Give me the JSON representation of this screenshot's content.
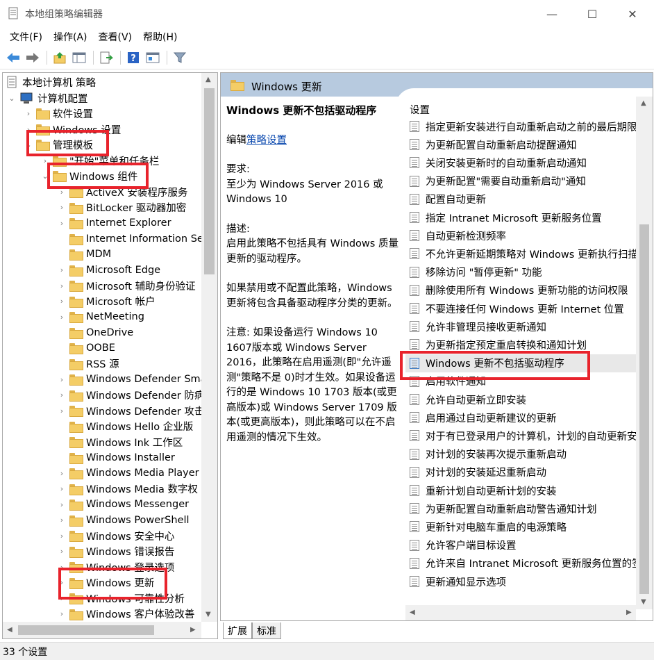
{
  "window": {
    "title": "本地组策略编辑器",
    "minimize": "—",
    "maximize": "☐",
    "close": "✕"
  },
  "menu": [
    "文件(F)",
    "操作(A)",
    "查看(V)",
    "帮助(H)"
  ],
  "tree": {
    "root": "本地计算机 策略",
    "computer_config": "计算机配置",
    "software_settings": "软件设置",
    "windows_settings": "Windows 设置",
    "admin_templates": "管理模板",
    "start_menu": "\"开始\"菜单和任务栏",
    "windows_components": "Windows 组件",
    "components": [
      "ActiveX 安装程序服务",
      "BitLocker 驱动器加密",
      "Internet Explorer",
      "Internet Information Ser",
      "MDM",
      "Microsoft Edge",
      "Microsoft 辅助身份验证",
      "Microsoft 帐户",
      "NetMeeting",
      "OneDrive",
      "OOBE",
      "RSS 源",
      "Windows Defender Sma",
      "Windows Defender 防病",
      "Windows Defender 攻击",
      "Windows Hello 企业版",
      "Windows Ink 工作区",
      "Windows Installer",
      "Windows Media Player",
      "Windows Media 数字权",
      "Windows Messenger",
      "Windows PowerShell",
      "Windows 安全中心",
      "Windows 错误报告",
      "Windows 登录选项",
      "Windows 更新",
      "Windows 可靠性分析",
      "Windows 客户体验改善"
    ]
  },
  "right": {
    "header": "Windows 更新",
    "description": {
      "title": "Windows 更新不包括驱动程序",
      "edit_prefix": "编辑",
      "edit_link": "策略设置",
      "requirement_label": "要求:",
      "requirement_text": "至少为 Windows Server 2016 或 Windows 10",
      "desc_label": "描述:",
      "desc_text": "启用此策略不包括具有 Windows 质量更新的驱动程序。",
      "disabled_text": "如果禁用或不配置此策略，Windows 更新将包含具备驱动程序分类的更新。",
      "note_text": "注意: 如果设备运行 Windows 10 1607版本或 Windows Server 2016，此策略在启用遥测(即\"允许遥测\"策略不是 0)时才生效。如果设备运行的是 Windows 10 1703 版本(或更高版本)或 Windows Server 1709 版本(或更高版本)，则此策略可以在不启用遥测的情况下生效。"
    },
    "list_header": "设置",
    "settings": [
      "指定更新安装进行自动重新启动之前的最后期限",
      "为更新配置自动重新启动提醒通知",
      "关闭安装更新时的自动重新启动通知",
      "为更新配置\"需要自动重新启动\"通知",
      "配置自动更新",
      "指定 Intranet Microsoft 更新服务位置",
      "自动更新检测频率",
      "不允许更新延期策略对 Windows 更新执行扫描",
      "移除访问 \"暂停更新\" 功能",
      "删除使用所有 Windows 更新功能的访问权限",
      "不要连接任何 Windows 更新 Internet 位置",
      "允许非管理员接收更新通知",
      "为更新指定预定重启转换和通知计划",
      "Windows 更新不包括驱动程序",
      "启用软件通知",
      "允许自动更新立即安装",
      "启用通过自动更新建议的更新",
      "对于有已登录用户的计算机，计划的自动更新安装",
      "对计划的安装再次提示重新启动",
      "对计划的安装延迟重新启动",
      "重新计划自动更新计划的安装",
      "为更新配置自动重新启动警告通知计划",
      "更新针对电脑车重启的电源策略",
      "允许客户端目标设置",
      "允许来自 Intranet Microsoft 更新服务位置的签",
      "更新通知显示选项"
    ],
    "selected_index": 13
  },
  "tabs": [
    "扩展",
    "标准"
  ],
  "status": "33 个设置",
  "colors": {
    "highlight": "#e8232c",
    "header_bg": "#b7cadf",
    "link": "#0645ad"
  }
}
